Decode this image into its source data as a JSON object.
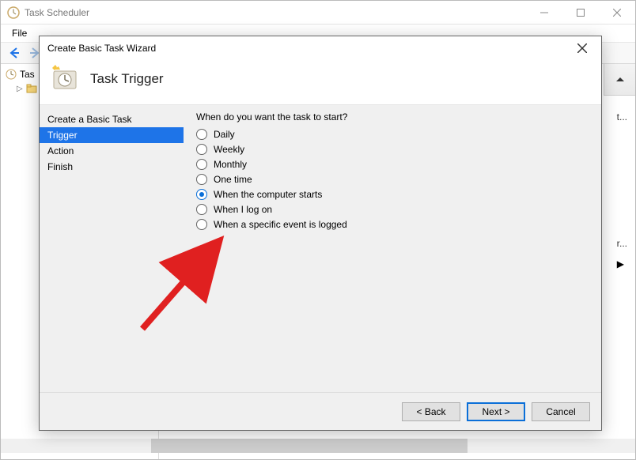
{
  "window": {
    "title": "Task Scheduler",
    "min_label": "Minimize",
    "max_label": "Maximize",
    "close_label": "Close"
  },
  "menubar": {
    "file": "File"
  },
  "toolbar": {
    "back": "Back",
    "forward": "Forward"
  },
  "tree": {
    "root": "Tas"
  },
  "right": {
    "trunc1": "t...",
    "trunc2": "r..."
  },
  "wizard": {
    "title": "Create Basic Task Wizard",
    "header": "Task Trigger",
    "nav": [
      {
        "label": "Create a Basic Task",
        "active": false
      },
      {
        "label": "Trigger",
        "active": true
      },
      {
        "label": "Action",
        "active": false
      },
      {
        "label": "Finish",
        "active": false
      }
    ],
    "question": "When do you want the task to start?",
    "options": [
      {
        "label": "Daily",
        "checked": false
      },
      {
        "label": "Weekly",
        "checked": false
      },
      {
        "label": "Monthly",
        "checked": false
      },
      {
        "label": "One time",
        "checked": false
      },
      {
        "label": "When the computer starts",
        "checked": true
      },
      {
        "label": "When I log on",
        "checked": false
      },
      {
        "label": "When a specific event is logged",
        "checked": false
      }
    ],
    "buttons": {
      "back": "< Back",
      "next": "Next >",
      "cancel": "Cancel"
    }
  }
}
